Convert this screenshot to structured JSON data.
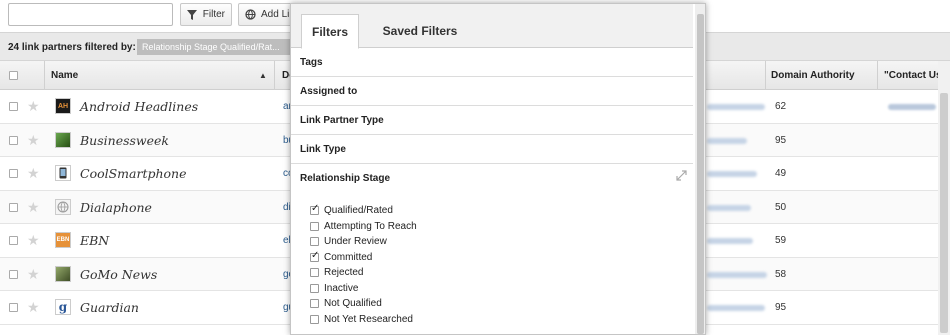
{
  "toolbar": {
    "search_value": "",
    "filter_label": "Filter",
    "add_link_label": "Add Li"
  },
  "summary": {
    "count_text": "24 link partners filtered by:",
    "tag_text": "Relationship Stage  Qualified/Rat..."
  },
  "table": {
    "headers": {
      "name": "Name",
      "domain": "Do",
      "domain_authority": "Domain Authority",
      "contact_us": "\"Contact Us\" U"
    },
    "rows": [
      {
        "name": "Android Headlines",
        "domain_prefix": "an",
        "domain_authority": "62",
        "logo_text": "AH",
        "logo_color": "#1a1a1a"
      },
      {
        "name": "Businessweek",
        "domain_prefix": "bu",
        "domain_authority": "95",
        "logo_text": "",
        "logo_color": "#6aa84f"
      },
      {
        "name": "CoolSmartphone",
        "domain_prefix": "co",
        "domain_authority": "49",
        "logo_text": "",
        "logo_color": "#e0e0e0"
      },
      {
        "name": "Dialaphone",
        "domain_prefix": "di",
        "domain_authority": "50",
        "logo_text": "",
        "logo_color": "#eaeaea"
      },
      {
        "name": "EBN",
        "domain_prefix": "eb",
        "domain_authority": "59",
        "logo_text": "EBN",
        "logo_color": "#e69138"
      },
      {
        "name": "GoMo News",
        "domain_prefix": "go",
        "domain_authority": "58",
        "logo_text": "",
        "logo_color": "#5b6f3d"
      },
      {
        "name": "Guardian",
        "domain_prefix": "gu",
        "domain_authority": "95",
        "logo_text": "g",
        "logo_color": "#2b5797"
      }
    ]
  },
  "filters_popup": {
    "tabs": [
      "Filters",
      "Saved Filters"
    ],
    "active_tab": "Filters",
    "sections": [
      "Tags",
      "Assigned to",
      "Link Partner Type",
      "Link Type",
      "Relationship Stage"
    ],
    "relationship_stage_options": [
      {
        "label": "Qualified/Rated",
        "checked": true
      },
      {
        "label": "Attempting To Reach",
        "checked": false
      },
      {
        "label": "Under Review",
        "checked": false
      },
      {
        "label": "Committed",
        "checked": true
      },
      {
        "label": "Rejected",
        "checked": false
      },
      {
        "label": "Inactive",
        "checked": false
      },
      {
        "label": "Not Qualified",
        "checked": false
      },
      {
        "label": "Not Yet Researched",
        "checked": false
      }
    ]
  },
  "icons": {
    "filter": "funnel-icon",
    "add_link": "globe-icon",
    "favorite": "star-icon",
    "sort": "sort-asc-icon",
    "collapse": "collapse-icon"
  }
}
